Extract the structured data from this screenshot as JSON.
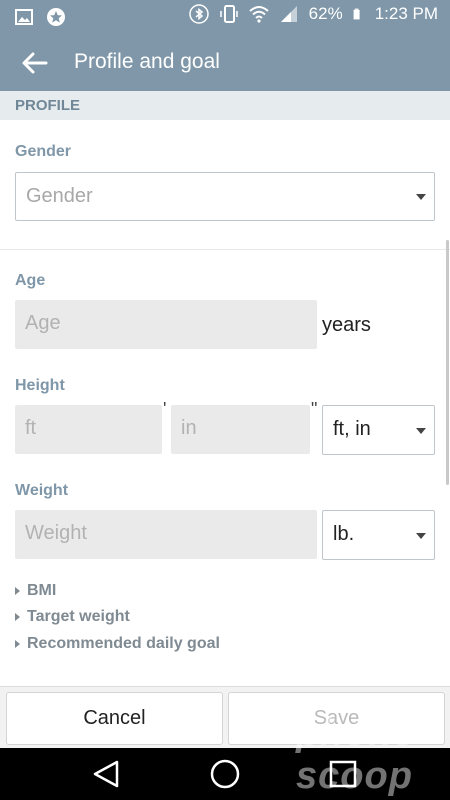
{
  "status_bar": {
    "battery_percent": "62%",
    "time": "1:23 PM",
    "icons": [
      "image-icon",
      "star-badge-icon",
      "bluetooth-icon",
      "vibrate-icon",
      "wifi-icon",
      "signal-icon",
      "battery-icon"
    ]
  },
  "app_bar": {
    "title": "Profile and goal",
    "back_icon": "arrow-left-icon"
  },
  "profile": {
    "section_title": "PROFILE",
    "gender": {
      "label": "Gender",
      "placeholder": "Gender"
    },
    "age": {
      "label": "Age",
      "placeholder": "Age",
      "unit": "years"
    },
    "height": {
      "label": "Height",
      "ft_placeholder": "ft",
      "in_placeholder": "in",
      "ft_mark": "'",
      "in_mark": "\"",
      "unit": "ft, in"
    },
    "weight": {
      "label": "Weight",
      "placeholder": "Weight",
      "unit": "lb."
    }
  },
  "expanders": [
    {
      "label": "BMI"
    },
    {
      "label": "Target weight"
    },
    {
      "label": "Recommended daily goal"
    }
  ],
  "buttons": {
    "cancel": "Cancel",
    "save": "Save"
  },
  "watermark": "phone scoop",
  "colors": {
    "header": "#7f97a8",
    "section_bg": "#e6ebee",
    "label": "#7f97a8"
  }
}
